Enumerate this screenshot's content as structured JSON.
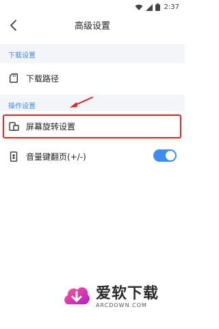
{
  "status_bar": {
    "time": "2:37",
    "icons": [
      "wifi-icon",
      "signal-icon",
      "battery-icon"
    ]
  },
  "app_bar": {
    "title": "高级设置",
    "back_icon": "chevron-left-icon"
  },
  "sections": [
    {
      "header": "下载设置",
      "items": [
        {
          "label": "下载路径",
          "icon": "sd-card-icon"
        }
      ]
    },
    {
      "header": "操作设置",
      "items": [
        {
          "label": "屏幕旋转设置",
          "icon": "screen-rotation-icon",
          "highlighted": true
        },
        {
          "label": "音量键翻页(+/-)",
          "icon": "phone-volume-icon",
          "toggle": true
        }
      ]
    }
  ],
  "annotation": {
    "color": "#e3231f"
  },
  "watermark": {
    "main": "爱软下载",
    "sub": "ARCDOWN.COM"
  },
  "colors": {
    "accent": "#3f8fe6",
    "toggle_on": "#3d8cf0",
    "section_bg": "#f3f5f8",
    "highlight": "#e3231f"
  }
}
